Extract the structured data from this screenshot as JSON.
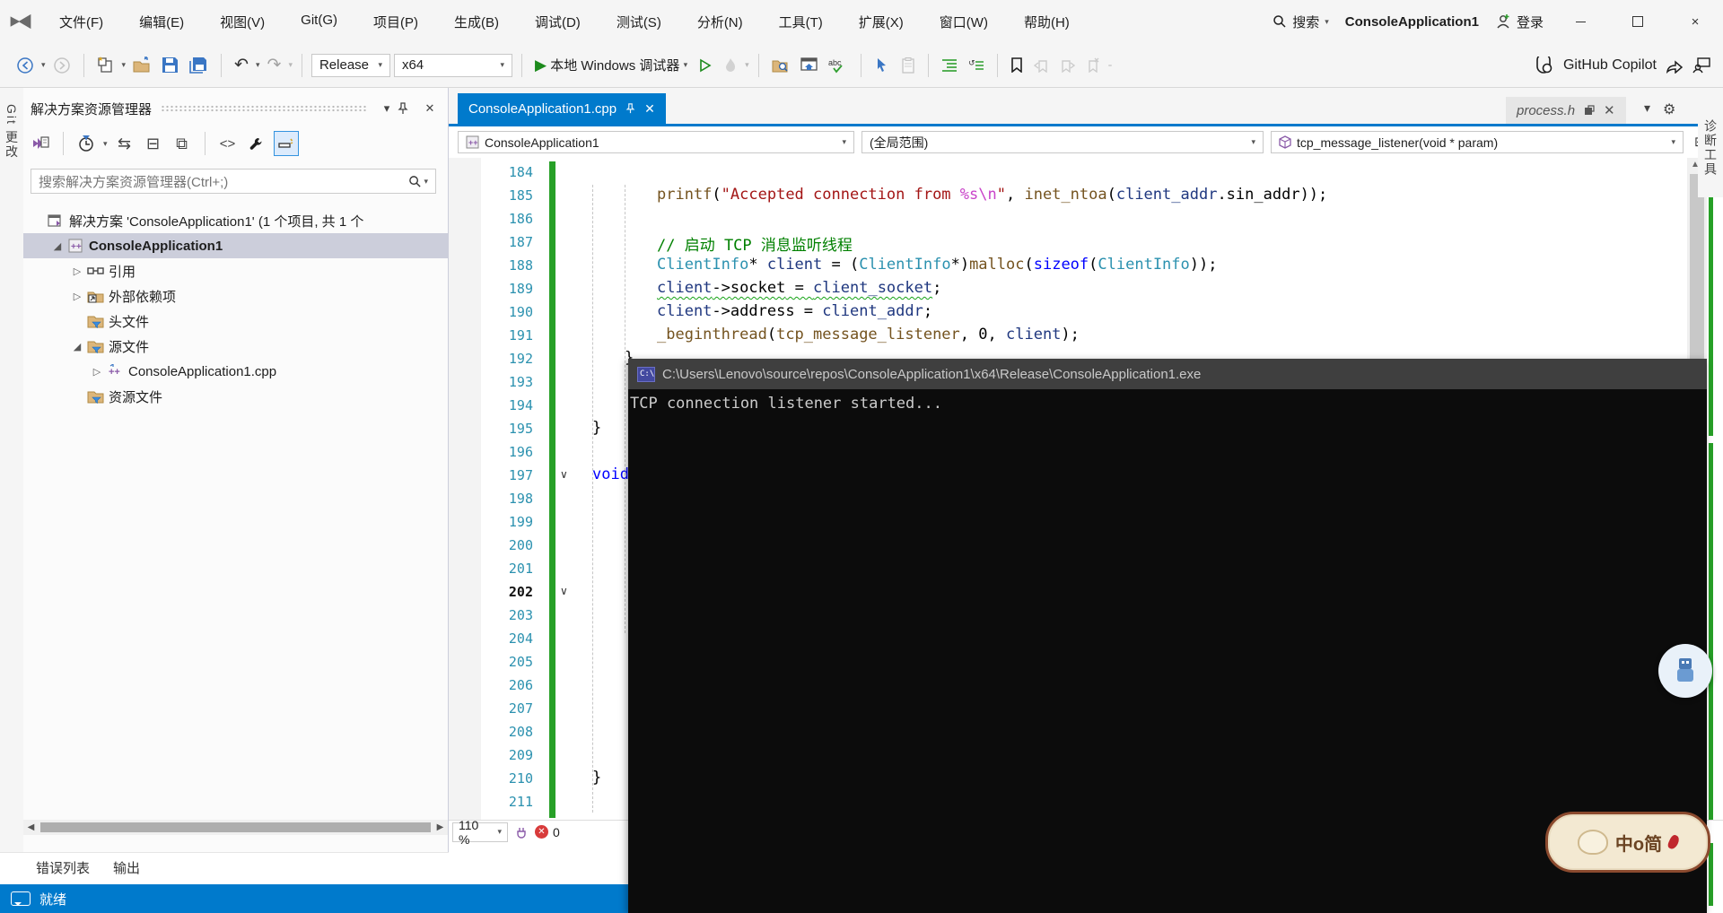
{
  "window": {
    "project_title": "ConsoleApplication1"
  },
  "menu": {
    "items": [
      "文件(F)",
      "编辑(E)",
      "视图(V)",
      "Git(G)",
      "项目(P)",
      "生成(B)",
      "调试(D)",
      "测试(S)",
      "分析(N)",
      "工具(T)",
      "扩展(X)",
      "窗口(W)",
      "帮助(H)"
    ],
    "search_label": "搜索",
    "signin_label": "登录"
  },
  "toolbar": {
    "config": "Release",
    "platform": "x64",
    "debug_target": "本地 Windows 调试器",
    "copilot_label": "GitHub Copilot"
  },
  "left_strip": {
    "git_changes_tab": "Git 更改"
  },
  "explorer": {
    "title": "解决方案资源管理器",
    "search_placeholder": "搜索解决方案资源管理器(Ctrl+;)",
    "tree": [
      {
        "label": "解决方案 'ConsoleApplication1' (1 个项目, 共 1 个",
        "icon": "solution",
        "indent": 0,
        "expander": "none",
        "bold": false,
        "selected": false
      },
      {
        "label": "ConsoleApplication1",
        "icon": "cppproj",
        "indent": 1,
        "expander": "expanded",
        "bold": true,
        "selected": true
      },
      {
        "label": "引用",
        "icon": "refs",
        "indent": 2,
        "expander": "collapsed",
        "bold": false,
        "selected": false
      },
      {
        "label": "外部依赖项",
        "icon": "extdep",
        "indent": 2,
        "expander": "collapsed",
        "bold": false,
        "selected": false
      },
      {
        "label": "头文件",
        "icon": "folderf",
        "indent": 2,
        "expander": "none",
        "bold": false,
        "selected": false
      },
      {
        "label": "源文件",
        "icon": "folderf",
        "indent": 2,
        "expander": "expanded",
        "bold": false,
        "selected": false
      },
      {
        "label": "ConsoleApplication1.cpp",
        "icon": "cppfile",
        "indent": 3,
        "expander": "collapsed",
        "bold": false,
        "selected": false
      },
      {
        "label": "资源文件",
        "icon": "folderf",
        "indent": 2,
        "expander": "none",
        "bold": false,
        "selected": false
      }
    ]
  },
  "editor": {
    "tab_label": "ConsoleApplication1.cpp",
    "ghost_tab_label": "process.h",
    "nav_project": "ConsoleApplication1",
    "nav_scope": "(全局范围)",
    "nav_member": "tcp_message_listener(void * param)",
    "zoom_level": "110 %",
    "error_count": "0",
    "right_tab_label": "诊断工具",
    "code_lines": [
      {
        "n": 184,
        "ind": 0,
        "tk": []
      },
      {
        "n": 185,
        "ind": 2,
        "tk": [
          {
            "t": "printf",
            "c": "f"
          },
          {
            "t": "(",
            "c": "p"
          },
          {
            "t": "\"Accepted connection from ",
            "c": "s"
          },
          {
            "t": "%s\\n",
            "c": "e"
          },
          {
            "t": "\"",
            "c": "s"
          },
          {
            "t": ", ",
            "c": "p"
          },
          {
            "t": "inet_ntoa",
            "c": "f"
          },
          {
            "t": "(",
            "c": "p"
          },
          {
            "t": "client_addr",
            "c": "v"
          },
          {
            "t": ".sin_addr",
            "c": "p"
          },
          {
            "t": "));",
            "c": "p"
          }
        ]
      },
      {
        "n": 186,
        "ind": 0,
        "tk": []
      },
      {
        "n": 187,
        "ind": 2,
        "tk": [
          {
            "t": "// 启动 TCP 消息监听线程",
            "c": "c"
          }
        ]
      },
      {
        "n": 188,
        "ind": 2,
        "tk": [
          {
            "t": "ClientInfo",
            "c": "t"
          },
          {
            "t": "* ",
            "c": "p"
          },
          {
            "t": "client",
            "c": "v"
          },
          {
            "t": " = (",
            "c": "p"
          },
          {
            "t": "ClientInfo",
            "c": "t"
          },
          {
            "t": "*)",
            "c": "p"
          },
          {
            "t": "malloc",
            "c": "f"
          },
          {
            "t": "(",
            "c": "p"
          },
          {
            "t": "sizeof",
            "c": "k"
          },
          {
            "t": "(",
            "c": "p"
          },
          {
            "t": "ClientInfo",
            "c": "t"
          },
          {
            "t": "));",
            "c": "p"
          }
        ]
      },
      {
        "n": 189,
        "ind": 2,
        "tk": [
          {
            "t": "client",
            "c": "v",
            "w": 1
          },
          {
            "t": "->",
            "c": "p",
            "w": 1
          },
          {
            "t": "socket",
            "c": "p",
            "w": 1
          },
          {
            "t": " = ",
            "c": "p",
            "w": 1
          },
          {
            "t": "client_socket",
            "c": "v",
            "w": 1
          },
          {
            "t": ";",
            "c": "p"
          }
        ]
      },
      {
        "n": 190,
        "ind": 2,
        "tk": [
          {
            "t": "client",
            "c": "v"
          },
          {
            "t": "->",
            "c": "p"
          },
          {
            "t": "address",
            "c": "p"
          },
          {
            "t": " = ",
            "c": "p"
          },
          {
            "t": "client_addr",
            "c": "v"
          },
          {
            "t": ";",
            "c": "p"
          }
        ]
      },
      {
        "n": 191,
        "ind": 2,
        "tk": [
          {
            "t": "_beginthread",
            "c": "f"
          },
          {
            "t": "(",
            "c": "p"
          },
          {
            "t": "tcp_message_listener",
            "c": "f"
          },
          {
            "t": ", ",
            "c": "p"
          },
          {
            "t": "0",
            "c": "p"
          },
          {
            "t": ", ",
            "c": "p"
          },
          {
            "t": "client",
            "c": "v"
          },
          {
            "t": ");",
            "c": "p"
          }
        ]
      },
      {
        "n": 192,
        "ind": 1,
        "tk": [
          {
            "t": "}",
            "c": "p"
          }
        ]
      },
      {
        "n": 193,
        "ind": 0,
        "tk": []
      },
      {
        "n": 194,
        "ind": 0,
        "tk": []
      },
      {
        "n": 195,
        "ind": 0,
        "tk": [
          {
            "t": "}",
            "c": "p"
          }
        ]
      },
      {
        "n": 196,
        "ind": 0,
        "tk": []
      },
      {
        "n": 197,
        "ind": 0,
        "fold": true,
        "tk": [
          {
            "t": "void",
            "c": "k"
          }
        ]
      },
      {
        "n": 198,
        "ind": 0,
        "tk": []
      },
      {
        "n": 199,
        "ind": 0,
        "tk": []
      },
      {
        "n": 200,
        "ind": 0,
        "tk": []
      },
      {
        "n": 201,
        "ind": 0,
        "tk": []
      },
      {
        "n": 202,
        "ind": 0,
        "fold": true,
        "current": true,
        "caretbox": true,
        "tk": []
      },
      {
        "n": 203,
        "ind": 0,
        "tk": []
      },
      {
        "n": 204,
        "ind": 0,
        "tk": []
      },
      {
        "n": 205,
        "ind": 0,
        "tk": []
      },
      {
        "n": 206,
        "ind": 0,
        "tk": []
      },
      {
        "n": 207,
        "ind": 0,
        "tk": []
      },
      {
        "n": 208,
        "ind": 0,
        "tk": []
      },
      {
        "n": 209,
        "ind": 0,
        "tk": []
      },
      {
        "n": 210,
        "ind": 0,
        "tk": [
          {
            "t": "}",
            "c": "p"
          }
        ]
      },
      {
        "n": 211,
        "ind": 0,
        "tk": []
      }
    ]
  },
  "console": {
    "title_path": "C:\\Users\\Lenovo\\source\\repos\\ConsoleApplication1\\x64\\Release\\ConsoleApplication1.exe",
    "output_line": "TCP connection listener started..."
  },
  "bottom": {
    "error_list_tab": "错误列表",
    "output_tab": "输出",
    "status_ready": "就绪"
  },
  "sticker": {
    "text": "中o简"
  }
}
